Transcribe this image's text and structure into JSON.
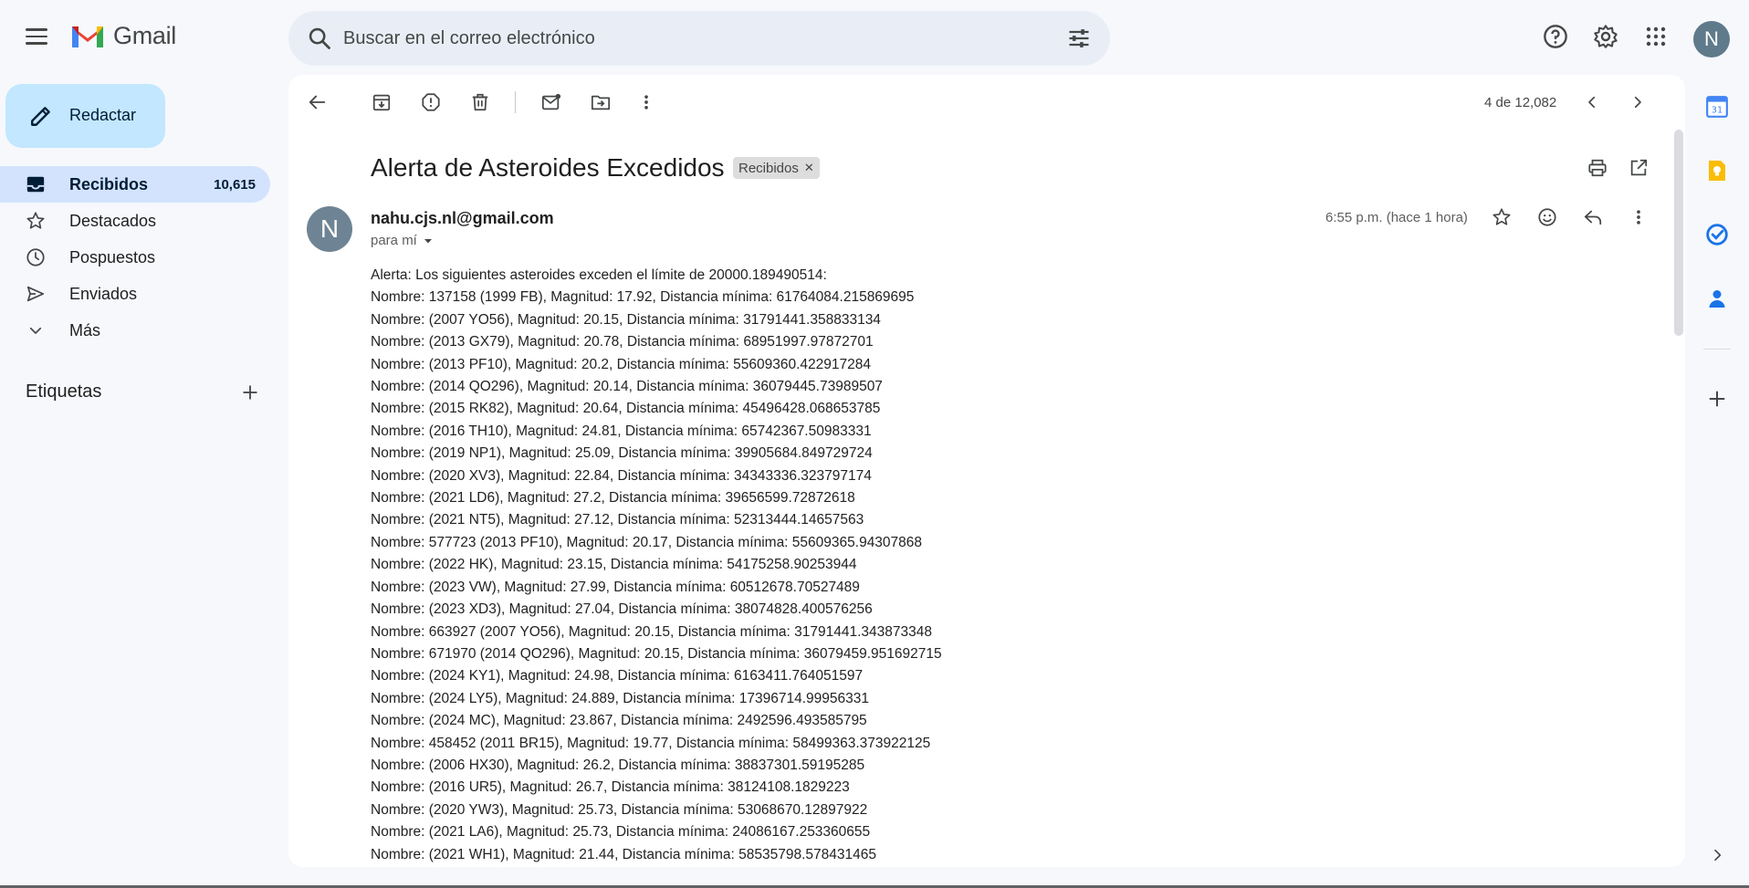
{
  "app": {
    "name": "Gmail"
  },
  "search": {
    "placeholder": "Buscar en el correo electrónico"
  },
  "user": {
    "avatar_initial": "N"
  },
  "compose": {
    "label": "Redactar"
  },
  "nav": {
    "items": [
      {
        "label": "Recibidos",
        "count": "10,615",
        "icon": "inbox-icon"
      },
      {
        "label": "Destacados",
        "icon": "star-icon"
      },
      {
        "label": "Pospuestos",
        "icon": "clock-icon"
      },
      {
        "label": "Enviados",
        "icon": "send-icon"
      },
      {
        "label": "Más",
        "icon": "chevron-down-icon"
      }
    ],
    "labels_title": "Etiquetas"
  },
  "toolbar": {
    "page_info": "4 de 12,082"
  },
  "email": {
    "subject": "Alerta de Asteroides Excedidos",
    "tag": "Recibidos",
    "sender_initial": "N",
    "sender": "nahu.cjs.nl@gmail.com",
    "to": "para mí",
    "time": "6:55 p.m. (hace 1 hora)",
    "body_lines": [
      "Alerta: Los siguientes asteroides exceden el límite de 20000.189490514:",
      "Nombre: 137158 (1999 FB), Magnitud: 17.92, Distancia mínima: 61764084.215869695",
      "Nombre: (2007 YO56), Magnitud: 20.15, Distancia mínima: 31791441.358833134",
      "Nombre: (2013 GX79), Magnitud: 20.78, Distancia mínima: 68951997.97872701",
      "Nombre: (2013 PF10), Magnitud: 20.2, Distancia mínima: 55609360.422917284",
      "Nombre: (2014 QO296), Magnitud: 20.14, Distancia mínima: 36079445.73989507",
      "Nombre: (2015 RK82), Magnitud: 20.64, Distancia mínima: 45496428.068653785",
      "Nombre: (2016 TH10), Magnitud: 24.81, Distancia mínima: 65742367.50983331",
      "Nombre: (2019 NP1), Magnitud: 25.09, Distancia mínima: 39905684.849729724",
      "Nombre: (2020 XV3), Magnitud: 22.84, Distancia mínima: 34343336.323797174",
      "Nombre: (2021 LD6), Magnitud: 27.2, Distancia mínima: 39656599.72872618",
      "Nombre: (2021 NT5), Magnitud: 27.12, Distancia mínima: 52313444.14657563",
      "Nombre: 577723 (2013 PF10), Magnitud: 20.17, Distancia mínima: 55609365.94307868",
      "Nombre: (2022 HK), Magnitud: 23.15, Distancia mínima: 54175258.90253944",
      "Nombre: (2023 VW), Magnitud: 27.99, Distancia mínima: 60512678.70527489",
      "Nombre: (2023 XD3), Magnitud: 27.04, Distancia mínima: 38074828.400576256",
      "Nombre: 663927 (2007 YO56), Magnitud: 20.15, Distancia mínima: 31791441.343873348",
      "Nombre: 671970 (2014 QO296), Magnitud: 20.15, Distancia mínima: 36079459.951692715",
      "Nombre: (2024 KY1), Magnitud: 24.98, Distancia mínima: 6163411.764051597",
      "Nombre: (2024 LY5), Magnitud: 24.889, Distancia mínima: 17396714.99956331",
      "Nombre: (2024 MC), Magnitud: 23.867, Distancia mínima: 2492596.493585795",
      "Nombre: 458452 (2011 BR15), Magnitud: 19.77, Distancia mínima: 58499363.373922125",
      "Nombre: (2006 HX30), Magnitud: 26.2, Distancia mínima: 38837301.59195285",
      "Nombre: (2016 UR5), Magnitud: 26.7, Distancia mínima: 38124108.1829223",
      "Nombre: (2020 YW3), Magnitud: 25.73, Distancia mínima: 53068670.12897922",
      "Nombre: (2021 LA6), Magnitud: 25.73, Distancia mínima: 24086167.253360655",
      "Nombre: (2021 WH1), Magnitud: 21.44, Distancia mínima: 58535798.578431465"
    ]
  },
  "colors": {
    "background": "#f6f8fc",
    "compose_bg": "#c2e7ff",
    "active_nav": "#d3e3fd",
    "search_bg": "#e9eef6"
  }
}
